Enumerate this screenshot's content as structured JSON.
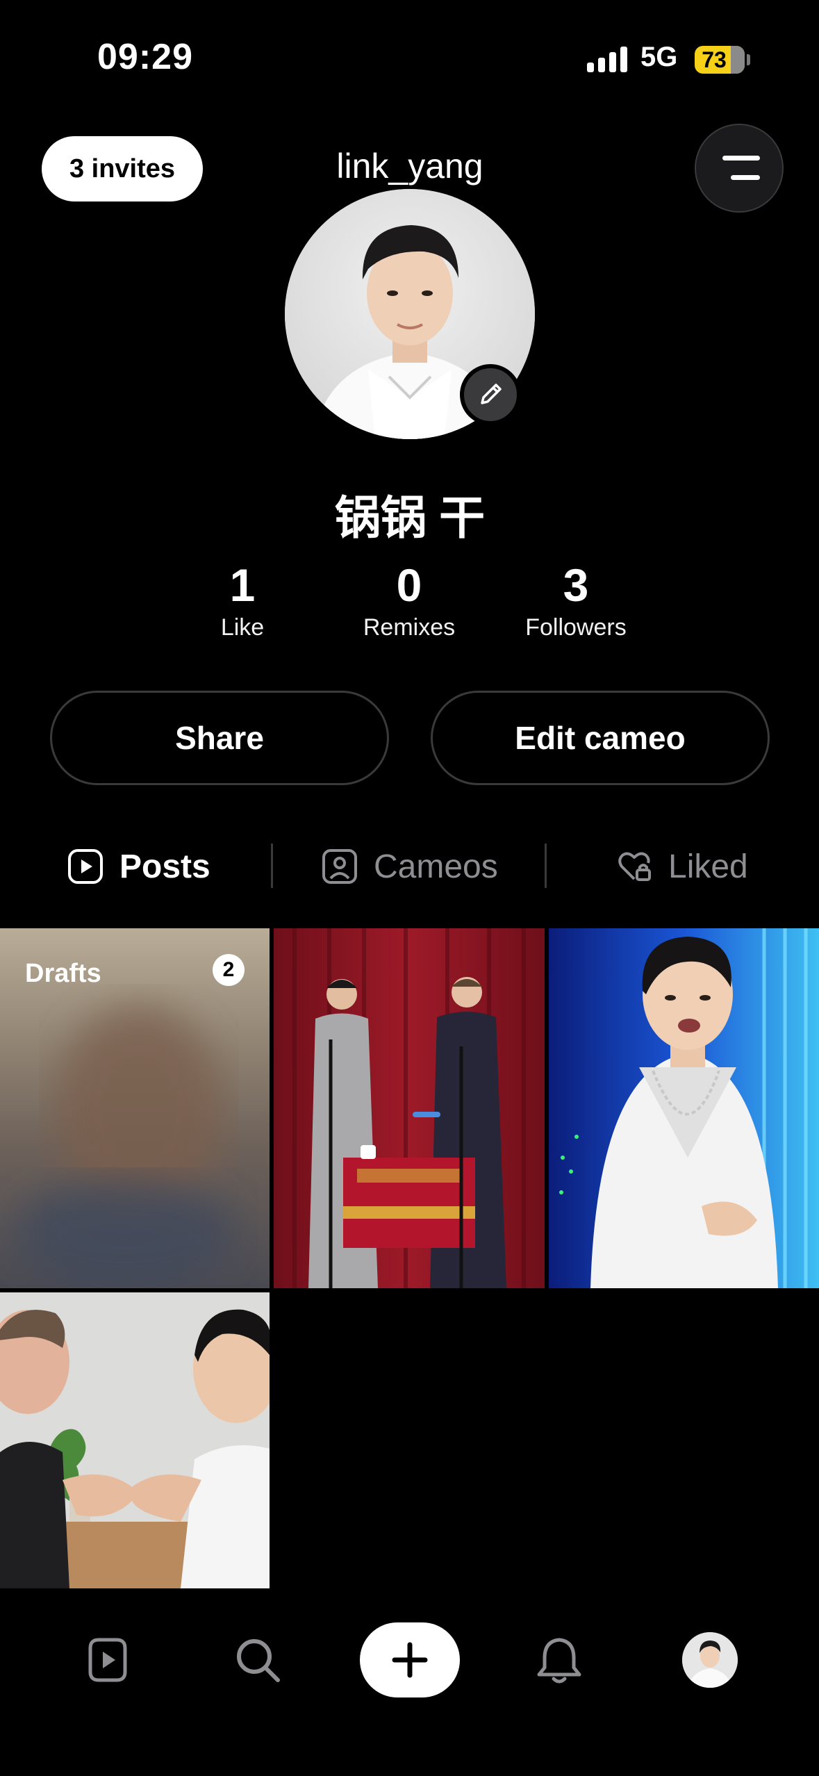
{
  "status_bar": {
    "time": "09:29",
    "network": "5G",
    "battery": "73",
    "battery_level": 0.73
  },
  "header": {
    "invites_label": "3 invites",
    "username": "link_yang",
    "menu_icon": "menu-lines-icon"
  },
  "profile": {
    "display_name": "锅锅 干",
    "edit_icon": "pencil-icon"
  },
  "stats": [
    {
      "value": "1",
      "label": "Like"
    },
    {
      "value": "0",
      "label": "Remixes"
    },
    {
      "value": "3",
      "label": "Followers"
    }
  ],
  "actions": {
    "share_label": "Share",
    "edit_cameo_label": "Edit cameo"
  },
  "tabs": [
    {
      "label": "Posts",
      "icon": "play-square-icon",
      "active": true
    },
    {
      "label": "Cameos",
      "icon": "person-square-icon",
      "active": false
    },
    {
      "label": "Liked",
      "icon": "heart-lock-icon",
      "active": false
    }
  ],
  "grid": {
    "drafts_label": "Drafts",
    "drafts_count": "2"
  },
  "nav": {
    "items": [
      "feed-icon",
      "search-icon",
      "plus-icon",
      "bell-icon",
      "profile-avatar"
    ]
  },
  "colors": {
    "background": "#000000",
    "battery": "#f7d118",
    "inactive": "#8e8e93",
    "border": "#3a3a3c"
  }
}
